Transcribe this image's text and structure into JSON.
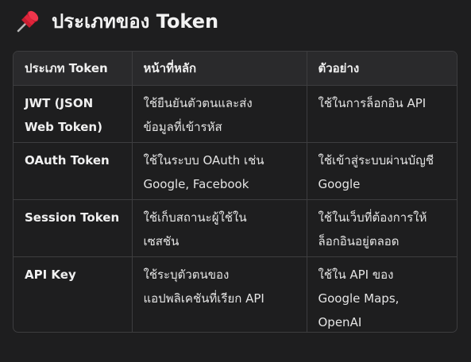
{
  "heading": {
    "icon": "pushpin-icon",
    "title": "ประเภทของ Token"
  },
  "table": {
    "headers": [
      "ประเภท Token",
      "หน้าที่หลัก",
      "ตัวอย่าง"
    ],
    "rows": [
      {
        "type_line1": "JWT (JSON",
        "type_line2": "Web Token)",
        "role_line1": "ใช้ยืนยันตัวตนและส่ง",
        "role_line2": "ข้อมูลที่เข้ารหัส",
        "example_line1": "ใช้ในการล็อกอิน API",
        "example_line2": ""
      },
      {
        "type_line1": "OAuth Token",
        "type_line2": "",
        "role_line1": "ใช้ในระบบ OAuth เช่น",
        "role_line2": "Google, Facebook",
        "example_line1": "ใช้เข้าสู่ระบบผ่านบัญชี",
        "example_line2": "Google"
      },
      {
        "type_line1": "Session Token",
        "type_line2": "",
        "role_line1": "ใช้เก็บสถานะผู้ใช้ใน",
        "role_line2": "เซสชัน",
        "example_line1": "ใช้ในเว็บที่ต้องการให้",
        "example_line2": "ล็อกอินอยู่ตลอด"
      },
      {
        "type_line1": "API Key",
        "type_line2": "",
        "role_line1": "ใช้ระบุตัวตนของ",
        "role_line2": "แอปพลิเคชันที่เรียก API",
        "example_line1": "ใช้ใน API ของ",
        "example_line2": "Google Maps,",
        "example_line3": "OpenAI"
      }
    ]
  },
  "colors": {
    "background": "#1e1e1f",
    "header_background": "#2a2a2c",
    "border": "#3d3d3f",
    "text": "#e8e8e8",
    "pin_red": "#e0243a"
  }
}
